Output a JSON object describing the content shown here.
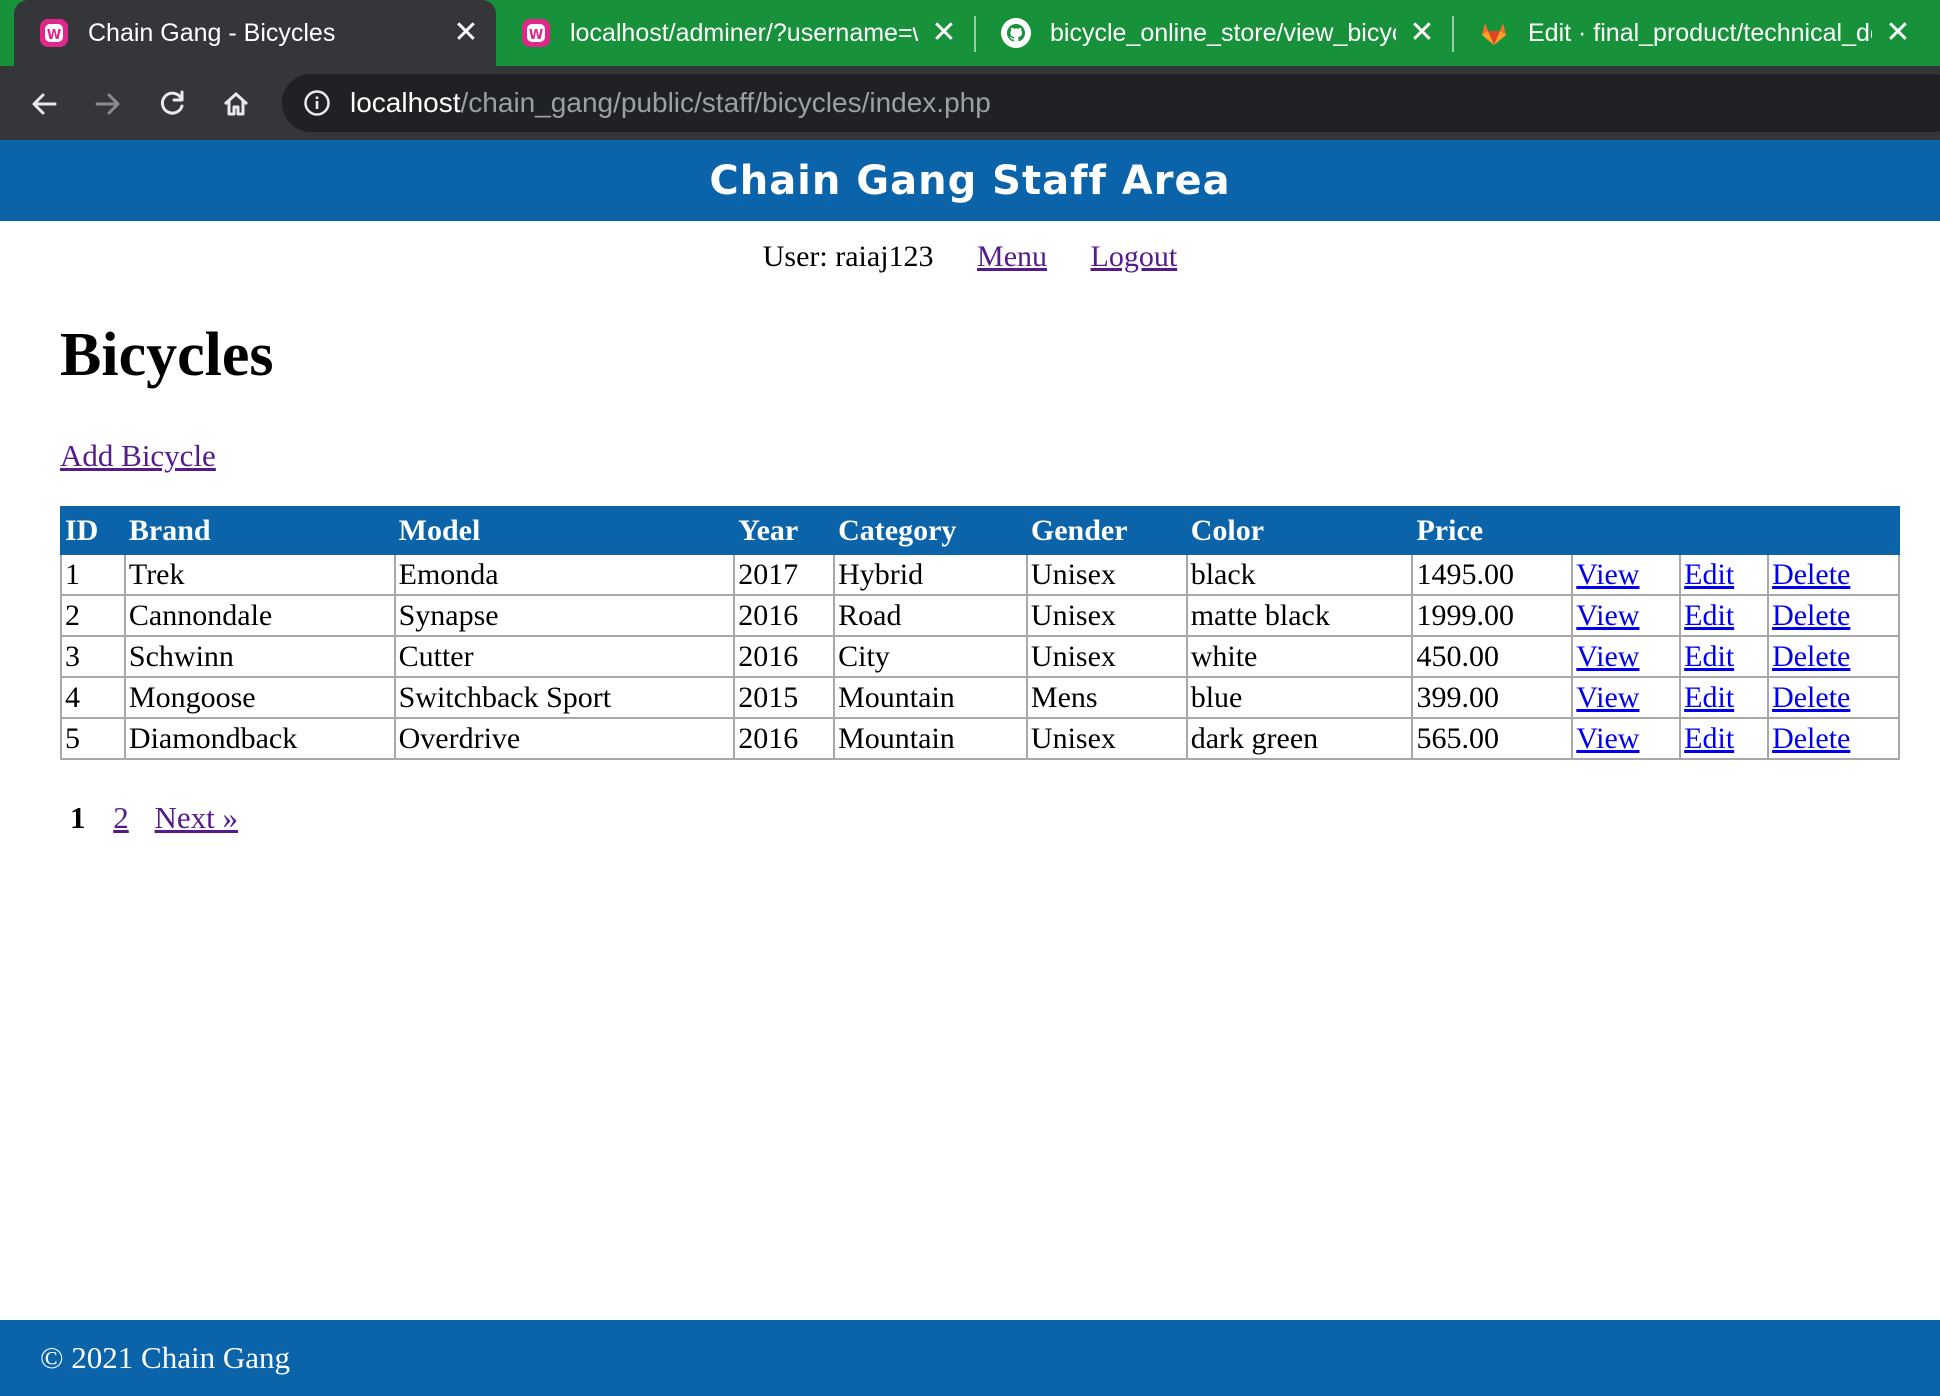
{
  "browser": {
    "tabs": [
      {
        "title": "Chain Gang - Bicycles",
        "icon": "wamp-icon",
        "active": true
      },
      {
        "title": "localhost/adminer/?username=w",
        "icon": "wamp-icon",
        "active": false
      },
      {
        "title": "bicycle_online_store/view_bicycle",
        "icon": "github-icon",
        "active": false
      },
      {
        "title": "Edit · final_product/technical_doc",
        "icon": "gitlab-icon",
        "active": false
      }
    ],
    "close_glyph": "✕",
    "address": {
      "host": "localhost",
      "path": "/chain_gang/public/staff/bicycles/index.php"
    }
  },
  "header": {
    "title": "Chain Gang Staff Area"
  },
  "user_nav": {
    "user_label": "User: raiaj123",
    "menu_link": "Menu",
    "logout_link": "Logout"
  },
  "page": {
    "title": "Bicycles",
    "add_link": "Add Bicycle"
  },
  "table": {
    "headers": [
      "ID",
      "Brand",
      "Model",
      "Year",
      "Category",
      "Gender",
      "Color",
      "Price",
      "",
      "",
      ""
    ],
    "action_labels": {
      "view": "View",
      "edit": "Edit",
      "delete": "Delete"
    },
    "rows": [
      {
        "id": "1",
        "brand": "Trek",
        "model": "Emonda",
        "year": "2017",
        "category": "Hybrid",
        "gender": "Unisex",
        "color": "black",
        "price": "1495.00"
      },
      {
        "id": "2",
        "brand": "Cannondale",
        "model": "Synapse",
        "year": "2016",
        "category": "Road",
        "gender": "Unisex",
        "color": "matte black",
        "price": "1999.00"
      },
      {
        "id": "3",
        "brand": "Schwinn",
        "model": "Cutter",
        "year": "2016",
        "category": "City",
        "gender": "Unisex",
        "color": "white",
        "price": "450.00"
      },
      {
        "id": "4",
        "brand": "Mongoose",
        "model": "Switchback Sport",
        "year": "2015",
        "category": "Mountain",
        "gender": "Mens",
        "color": "blue",
        "price": "399.00"
      },
      {
        "id": "5",
        "brand": "Diamondback",
        "model": "Overdrive",
        "year": "2016",
        "category": "Mountain",
        "gender": "Unisex",
        "color": "dark green",
        "price": "565.00"
      }
    ]
  },
  "pagination": {
    "current": "1",
    "pages": [
      "2"
    ],
    "next": "Next »"
  },
  "footer": {
    "text": "© 2021 Chain Gang"
  },
  "colors": {
    "brand_blue": "#0b63a9",
    "tab_strip": "#17913a",
    "chrome_dark": "#35363a"
  }
}
